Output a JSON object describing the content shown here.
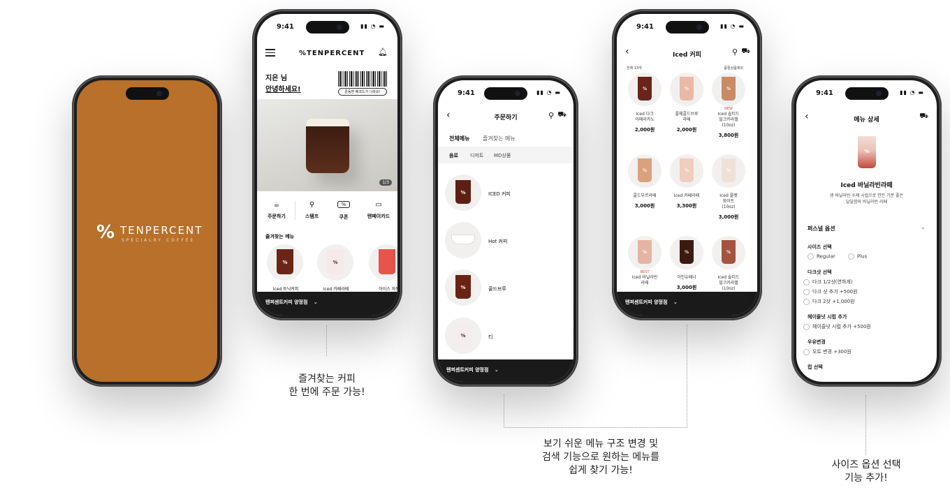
{
  "splash": {
    "brand": "TENPERCENT",
    "tagline": "SPECIALRY COFFEE",
    "logo_mark": "%"
  },
  "home": {
    "time": "9:41",
    "logo": "%TENPERCENT",
    "greeting_name": "지은 님",
    "greeting_text": "안녕하세요!",
    "barcode_note": "준동면 배코드가 나와요!",
    "banner_page": "1/3",
    "quick_menu": [
      "주문하기",
      "스탬프",
      "쿠폰",
      "텐페이카드"
    ],
    "coupon_icon_label": "%",
    "favorites_title": "즐겨찾는 메뉴",
    "favorites": [
      "Iced 토닉커피",
      "Iced 카페라떼",
      "아이스 자몽"
    ],
    "store": "텐퍼센트커피 양정점"
  },
  "order": {
    "time": "9:41",
    "title": "주문하기",
    "tabs": [
      "전체메뉴",
      "즐겨찾는 메뉴"
    ],
    "subtabs": [
      "음료",
      "디저트",
      "MD상품"
    ],
    "categories": [
      "ICED 커피",
      "Hot 커피",
      "콜드브루",
      "티"
    ],
    "store": "텐퍼센트커피 양정점"
  },
  "list": {
    "time": "9:41",
    "title": "Iced 커피",
    "count": "전체 13개",
    "sort": "품절상품제외",
    "products": [
      {
        "name": "Iced 다크\n아메리카노",
        "price": "2,000원",
        "badge": ""
      },
      {
        "name": "플체콜드브루\n라떼",
        "price": "2,000원",
        "badge": ""
      },
      {
        "name": "Iced 솔티드\n밀크카라멜\n(10oz)",
        "price": "3,800원",
        "badge": "NEW"
      },
      {
        "name": "콜드부르라떼",
        "price": "3,000원",
        "badge": ""
      },
      {
        "name": "Iced 카페라떼",
        "price": "3,300원",
        "badge": ""
      },
      {
        "name": "Iced 플랫\n화이트\n(10oz)",
        "price": "3,000원",
        "badge": ""
      },
      {
        "name": "Iced 바닐라빈\n라떼",
        "price": "",
        "badge": "BEST"
      },
      {
        "name": "아인슈페너",
        "price": "3,000원",
        "badge": ""
      },
      {
        "name": "Iced 솔티드\n밀크카라멜\n(10oz)",
        "price": "",
        "badge": ""
      }
    ],
    "store": "텐퍼센트커피 양정점"
  },
  "detail": {
    "time": "9:41",
    "title": "메뉴 상세",
    "product_name": "Iced 바닐라빈라떼",
    "description": "생 바닐라빈 수제 시럽으로 만든 기분 좋은\n달달함의 바닐라빈 라떼",
    "section": "퍼스널 옵션",
    "groups": [
      {
        "title": "사이즈 선택",
        "options": [
          "Regular",
          "Plus"
        ]
      },
      {
        "title": "다크샷 선택",
        "options": [
          "다크 1/2샷(연하게)",
          "다크 샷 추가 +500원",
          "다크 2샷 +1,000원"
        ]
      },
      {
        "title": "헤이즐넛 시럽 추가",
        "options": [
          "헤이즐넛 시럽 추가 +500원"
        ]
      },
      {
        "title": "우유변경",
        "options": [
          "오트 변경 +300원"
        ]
      },
      {
        "title": "컵 선택",
        "options": []
      }
    ]
  },
  "captions": {
    "home": "즐겨찾는 커피\n한 번에 주문 가능!",
    "order": "보기 쉬운 메뉴 구조 변경 및\n검색 기능으로 원하는 메뉴를\n쉽게 찾기 가능!",
    "detail": "사이즈 옵션 선택\n기능 추가!"
  },
  "colors": {
    "splash_bg": "#b8702a",
    "dark": "#1a1a1a",
    "coffee": "#5a2418",
    "red_badge": "#e0443a"
  }
}
